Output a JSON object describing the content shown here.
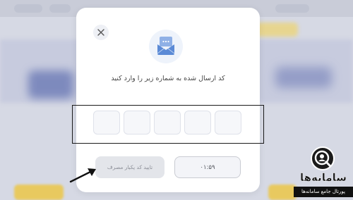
{
  "modal": {
    "prompt": "کد ارسال شده به شماره زیر را وارد کنید",
    "otp_digits": [
      "",
      "",
      "",
      "",
      ""
    ],
    "submit_label": "تایید کد یکبار مصرف",
    "timer": "۰۱:۵۹"
  },
  "icons": {
    "close": "close-icon",
    "mail": "mail-icon",
    "arrow": "arrow-icon"
  },
  "watermark": {
    "title": "سامانه‌ها",
    "subtitle": "پورتال جامع سامانه‌ها"
  },
  "colors": {
    "primary_light": "#eef3fb",
    "mail_icon": "#5b8ad6",
    "button_disabled": "#e3e5ea"
  }
}
